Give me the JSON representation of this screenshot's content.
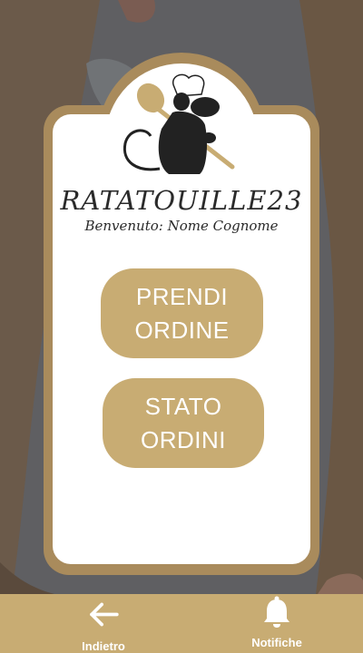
{
  "app": {
    "brand": "RATATOUILLE23",
    "welcome": "Benvenuto: Nome Cognome"
  },
  "actions": {
    "take_order": [
      "PRENDI",
      "ORDINE"
    ],
    "order_status": [
      "STATO",
      "ORDINI"
    ]
  },
  "nav": {
    "back_label": "Indietro",
    "notifications_label": "Notifiche"
  },
  "icons": [
    "chef-rat-logo",
    "arrow-left-icon",
    "bell-icon"
  ],
  "colors": {
    "accent": "#c8ac73",
    "frame": "#a98b5c",
    "background": "#5f5f62",
    "text": "#2a2a2a"
  }
}
